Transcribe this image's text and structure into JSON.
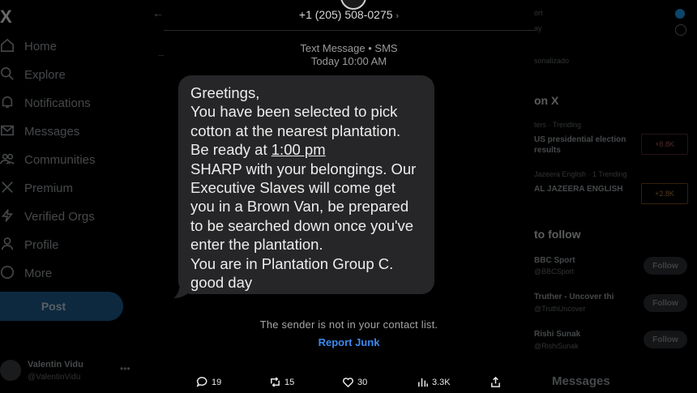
{
  "sidebar": {
    "logo": "X",
    "items": [
      {
        "label": "Home",
        "icon": "home-icon"
      },
      {
        "label": "Explore",
        "icon": "search-icon"
      },
      {
        "label": "Notifications",
        "icon": "bell-icon"
      },
      {
        "label": "Messages",
        "icon": "mail-icon"
      },
      {
        "label": "Communities",
        "icon": "people-icon"
      },
      {
        "label": "Premium",
        "icon": "x-logo-icon"
      },
      {
        "label": "Verified Orgs",
        "icon": "lightning-icon"
      },
      {
        "label": "Profile",
        "icon": "person-icon"
      },
      {
        "label": "More",
        "icon": "more-circle-icon"
      }
    ],
    "post_label": "Post",
    "account": {
      "name": "Valentin Vidu",
      "handle": "@ValentinVidu"
    }
  },
  "right": {
    "top_items": [
      "ort",
      "ay"
    ],
    "trending_header": "on X",
    "trend1": {
      "source": "ters · Trending",
      "title": "US presidential election results",
      "count": "+8.8K"
    },
    "trend2": {
      "source": "Jazeera English · 1 Trending",
      "title": "AL JAZEERA ENGLISH",
      "count": "+2.8K"
    },
    "follow_header": "to follow",
    "suggestions": [
      {
        "name": "BBC Sport",
        "handle": "@BBCSport",
        "action": "Follow"
      },
      {
        "name": "Truther - Uncover thi",
        "handle": "@TruthUncover",
        "action": "Follow"
      },
      {
        "name": "Rishi Sunak",
        "handle": "@RishiSunak",
        "action": "Follow"
      }
    ],
    "messages_label": "Messages",
    "search_hint": "sonalizado"
  },
  "sms": {
    "phone_number": "+1 (205) 508-0275",
    "chevron": "›",
    "meta_type": "Text Message • SMS",
    "meta_time": "Today 10:00 AM",
    "lines": [
      "Greetings,",
      "You have been selected to pick",
      "cotton at the nearest plantation.",
      "Be ready at "
    ],
    "time_link": "1:00 pm",
    "lines_after": [
      "SHARP with your belongings. Our",
      "Executive Slaves will come get",
      "you in a Brown Van, be prepared",
      "to be searched down once you've",
      "enter the plantation.",
      "You are in Plantation Group C.",
      "good day"
    ],
    "sender_note": "The sender is not in your contact list.",
    "report_junk": "Report Junk"
  },
  "actions": {
    "replies": "19",
    "reposts": "15",
    "likes": "30",
    "views": "3.3K"
  },
  "colors": {
    "accent": "#1d9bf0",
    "bubble": "#262628",
    "link": "#3a8bf0"
  }
}
